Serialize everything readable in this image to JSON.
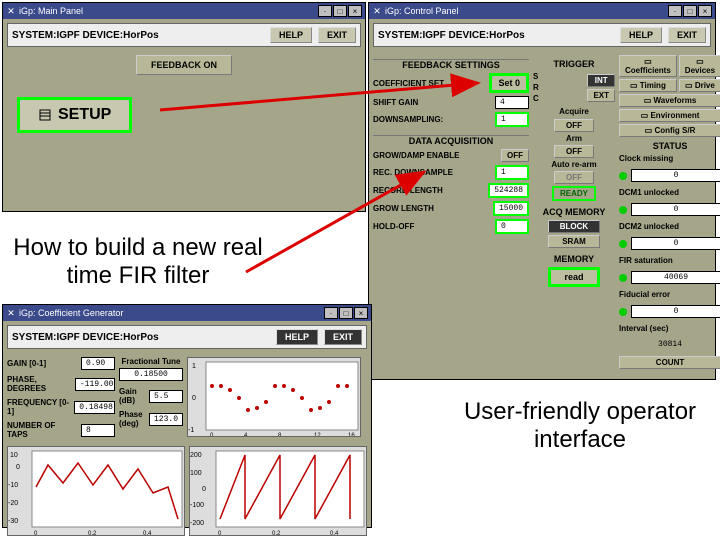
{
  "captions": {
    "howto": "How to build a new real time FIR filter",
    "userfriendly": "User-friendly operator interface"
  },
  "main_panel": {
    "title": "iGp: Main Panel",
    "header": "SYSTEM:IGPF DEVICE:HorPos",
    "help": "HELP",
    "exit": "EXIT",
    "feedback_on": "FEEDBACK ON",
    "setup": "SETUP"
  },
  "control_panel": {
    "title": "iGp: Control Panel",
    "header": "SYSTEM:IGPF DEVICE:HorPos",
    "help": "HELP",
    "exit": "EXIT",
    "feedback_settings": "FEEDBACK SETTINGS",
    "coef_set_label": "COEFFICIENT SET",
    "coef_set_val": "Set 0",
    "shift_gain_label": "SHIFT GAIN",
    "shift_gain_val": "4",
    "downsample_label": "DOWNSAMPLING:",
    "downsample_val": "1",
    "data_acq": "DATA ACQUISITION",
    "growdamp_label": "GROW/DAMP ENABLE",
    "growdamp_val": "OFF",
    "rec_down_label": "REC. DOWNSAMPLE",
    "rec_down_val": "1",
    "rec_len_label": "RECORD LENGTH",
    "rec_len_val": "524288",
    "grow_len_label": "GROW LENGTH",
    "grow_len_val": "15000",
    "holdoff_label": "HOLD-OFF",
    "holdoff_val": "0",
    "trigger": "TRIGGER",
    "trig_s": "S",
    "trig_r": "R",
    "trig_c": "C",
    "int": "INT",
    "ext": "EXT",
    "acquire": "Acquire",
    "off": "OFF",
    "arm": "Arm",
    "autorearm": "Auto re-arm",
    "ready": "READY",
    "acq_memory": "ACQ MEMORY",
    "block": "BLOCK",
    "sram": "SRAM",
    "memory": "MEMORY",
    "read": "read",
    "right": {
      "coefficients": "Coefficients",
      "devices": "Devices",
      "timing": "Timing",
      "drive": "Drive",
      "waveforms": "Waveforms",
      "environment": "Environment",
      "config_sr": "Config S/R",
      "status": "STATUS",
      "clock_missing": "Clock missing",
      "clock_missing_val": "0",
      "dcm1": "DCM1 unlocked",
      "dcm1_val": "0",
      "dcm2": "DCM2 unlocked",
      "dcm2_val": "0",
      "fir_sat": "FIR saturation",
      "fir_sat_val": "40069",
      "fiducial": "Fiducial error",
      "fiducial_val": "0",
      "interval": "Interval (sec)",
      "interval_val": "30814",
      "count": "COUNT"
    }
  },
  "coef_gen": {
    "title": "iGp: Coefficient Generator",
    "header": "SYSTEM:IGPF DEVICE:HorPos",
    "help": "HELP",
    "exit": "EXIT",
    "gain_label": "GAIN [0-1]",
    "gain_val": "0.90",
    "phase_label": "PHASE, DEGREES",
    "phase_val": "-119.00",
    "freq_label": "FREQUENCY [0-1]",
    "freq_val": "0.18498",
    "taps_label": "NUMBER OF TAPS",
    "taps_val": "8",
    "frac_tune": "Fractional Tune",
    "frac_tune_val": "0.18500",
    "gain_db": "Gain (dB)",
    "gain_db_val": "5.5",
    "phase_deg": "Phase (deg)",
    "phase_deg_val": "123.0"
  },
  "chart_data": [
    {
      "type": "scatter",
      "title": "",
      "x": [
        0,
        1,
        2,
        3,
        4,
        5,
        6,
        7,
        8,
        9,
        10,
        11,
        12,
        13,
        14,
        15,
        16
      ],
      "values": [
        0.35,
        0.35,
        0.25,
        0,
        -0.3,
        -0.25,
        -0.1,
        0.3,
        0.35,
        0.25,
        0,
        -0.3,
        -0.25,
        -0.1,
        0.3,
        0.35,
        0.25
      ],
      "xlim": [
        0,
        16
      ],
      "ylim": [
        -1,
        1
      ],
      "xlabel": "",
      "ylabel": ""
    },
    {
      "type": "line",
      "categories": [
        0,
        0.05,
        0.1,
        0.15,
        0.2,
        0.25,
        0.3,
        0.35,
        0.4,
        0.45,
        0.5
      ],
      "values": [
        -12,
        2,
        -7,
        3,
        -8,
        2,
        -10,
        0,
        -13,
        -8,
        -30
      ],
      "xlim": [
        0,
        0.5
      ],
      "ylim": [
        -30,
        10
      ],
      "xlabel": "",
      "ylabel": "",
      "title": ""
    },
    {
      "type": "line",
      "categories": [
        0,
        0.05,
        0.1,
        0.15,
        0.2,
        0.25,
        0.3,
        0.35,
        0.4,
        0.45,
        0.5
      ],
      "values": [
        -150,
        50,
        200,
        -150,
        50,
        200,
        -150,
        50,
        200,
        -150,
        50
      ],
      "xlim": [
        0,
        0.5
      ],
      "ylim": [
        -200,
        200
      ],
      "xlabel": "",
      "ylabel": "",
      "title": ""
    }
  ]
}
